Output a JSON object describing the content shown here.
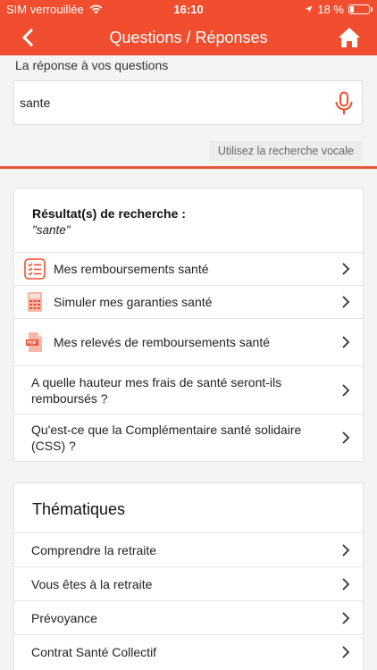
{
  "status_bar": {
    "carrier": "SIM verrouillée",
    "time": "16:10",
    "battery": "18 %",
    "battery_level": 0.18
  },
  "header": {
    "title": "Questions / Réponses",
    "back_icon": "chevron-left-icon",
    "home_icon": "home-icon"
  },
  "search": {
    "label": "La réponse à vos questions",
    "value": "sante",
    "mic_icon": "microphone-icon",
    "voice_hint": "Utilisez la recherche vocale"
  },
  "results": {
    "heading": "Résultat(s) de recherche :",
    "query": "\"sante\"",
    "items": [
      {
        "label": "Mes remboursements santé",
        "icon": "checklist-icon"
      },
      {
        "label": "Simuler mes garanties santé",
        "icon": "calculator-icon"
      },
      {
        "label": "Mes relevés de remboursements santé",
        "icon": "pdf-icon"
      },
      {
        "label": "A quelle hauteur mes frais de santé seront-ils remboursés ?",
        "icon": ""
      },
      {
        "label": "Qu'est-ce que la Complémentaire santé solidaire (CSS) ?",
        "icon": ""
      }
    ]
  },
  "themes": {
    "heading": "Thématiques",
    "items": [
      {
        "label": "Comprendre la retraite"
      },
      {
        "label": "Vous êtes à la retraite"
      },
      {
        "label": "Prévoyance"
      },
      {
        "label": "Contrat Santé Collectif"
      }
    ]
  },
  "colors": {
    "brand": "#f04e2f",
    "divider": "#e8553c"
  }
}
